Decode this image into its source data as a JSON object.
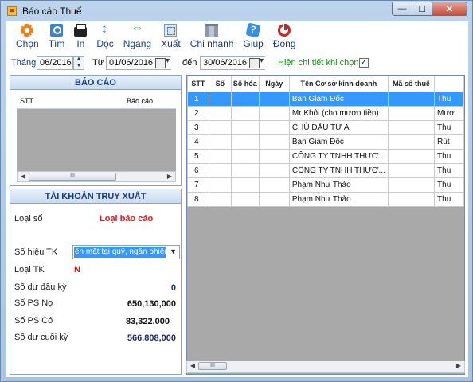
{
  "window": {
    "title": "Báo cáo Thuế",
    "buttons": {
      "minimize": "—",
      "maximize": "☐",
      "close": "✕"
    }
  },
  "toolbar": {
    "items": [
      {
        "label": "Chọn",
        "icon": "gear-icon"
      },
      {
        "label": "Tìm",
        "icon": "search-icon"
      },
      {
        "label": "In",
        "icon": "printer-icon"
      },
      {
        "label": "Dọc",
        "icon": "vertical-arrows-icon"
      },
      {
        "label": "Ngang",
        "icon": "horizontal-arrows-icon"
      },
      {
        "label": "Xuất",
        "icon": "export-icon"
      },
      {
        "label": "Chi nhánh",
        "icon": "building-icon"
      },
      {
        "label": "Giúp",
        "icon": "help-icon"
      },
      {
        "label": "Đóng",
        "icon": "power-icon"
      }
    ]
  },
  "filters": {
    "month_label": "Tháng",
    "month_value": "06/2016",
    "from_label": "Từ",
    "from_value": "01/06/2016",
    "to_label": "đến",
    "to_value": "30/06/2016",
    "detail_label": "Hiện chi tiết khi chọn",
    "detail_checked": "✓"
  },
  "report_panel": {
    "title": "BÁO CÁO",
    "columns": [
      "STT",
      "Báo cáo"
    ],
    "scroll_thumb": "III"
  },
  "account_panel": {
    "title": "TÀI KHOẢN TRUY XUẤT",
    "loai_so_label": "Loại sổ",
    "loai_so_value": "Loại báo cáo",
    "so_hieu_tk_label": "Số hiệu TK",
    "so_hieu_tk_value": "ền mặt tại quỹ, ngân phiếu",
    "loai_tk_label": "Loại TK",
    "loai_tk_value": "N",
    "so_du_dau_ky_label": "Số dư đầu kỳ",
    "so_du_dau_ky_value": "0",
    "so_ps_no_label": "Số PS Nợ",
    "so_ps_no_value": "650,130,000",
    "so_ps_co_label": "Số PS Có",
    "so_ps_co_value": "83,322,000",
    "so_du_cuoi_ky_label": "Số dư cuối kỳ",
    "so_du_cuoi_ky_value": "566,808,000"
  },
  "grid": {
    "columns": [
      "STT",
      "Số",
      "Số hóa",
      "Ngày",
      "Tên Cơ sở kinh doanh",
      "Mã số thuế",
      ""
    ],
    "rows": [
      {
        "stt": "1",
        "so": "",
        "so_hoa": "",
        "ngay": "",
        "ten": "Ban Giám Đốc",
        "mst": "",
        "extra": "Thu"
      },
      {
        "stt": "2",
        "so": "",
        "so_hoa": "",
        "ngay": "",
        "ten": "Mr Khôi (cho mượn tiền)",
        "mst": "",
        "extra": "Mượ"
      },
      {
        "stt": "3",
        "so": "",
        "so_hoa": "",
        "ngay": "",
        "ten": "CHỦ ĐẦU TƯ A",
        "mst": "",
        "extra": "Thu"
      },
      {
        "stt": "4",
        "so": "",
        "so_hoa": "",
        "ngay": "",
        "ten": "Ban Giám Đốc",
        "mst": "",
        "extra": "Rút"
      },
      {
        "stt": "5",
        "so": "",
        "so_hoa": "",
        "ngay": "",
        "ten": "CÔNG TY TNHH THƯƠ...",
        "mst": "",
        "extra": "Thu"
      },
      {
        "stt": "6",
        "so": "",
        "so_hoa": "",
        "ngay": "",
        "ten": "CÔNG TY TNHH THƯƠ...",
        "mst": "",
        "extra": "Thu"
      },
      {
        "stt": "7",
        "so": "",
        "so_hoa": "",
        "ngay": "",
        "ten": "Phạm Như Thảo",
        "mst": "",
        "extra": "Thu"
      },
      {
        "stt": "8",
        "so": "",
        "so_hoa": "",
        "ngay": "",
        "ten": "Phạm Như Thảo",
        "mst": "",
        "extra": "Thu"
      }
    ],
    "selected_row": 0,
    "scroll_thumb": "III"
  }
}
